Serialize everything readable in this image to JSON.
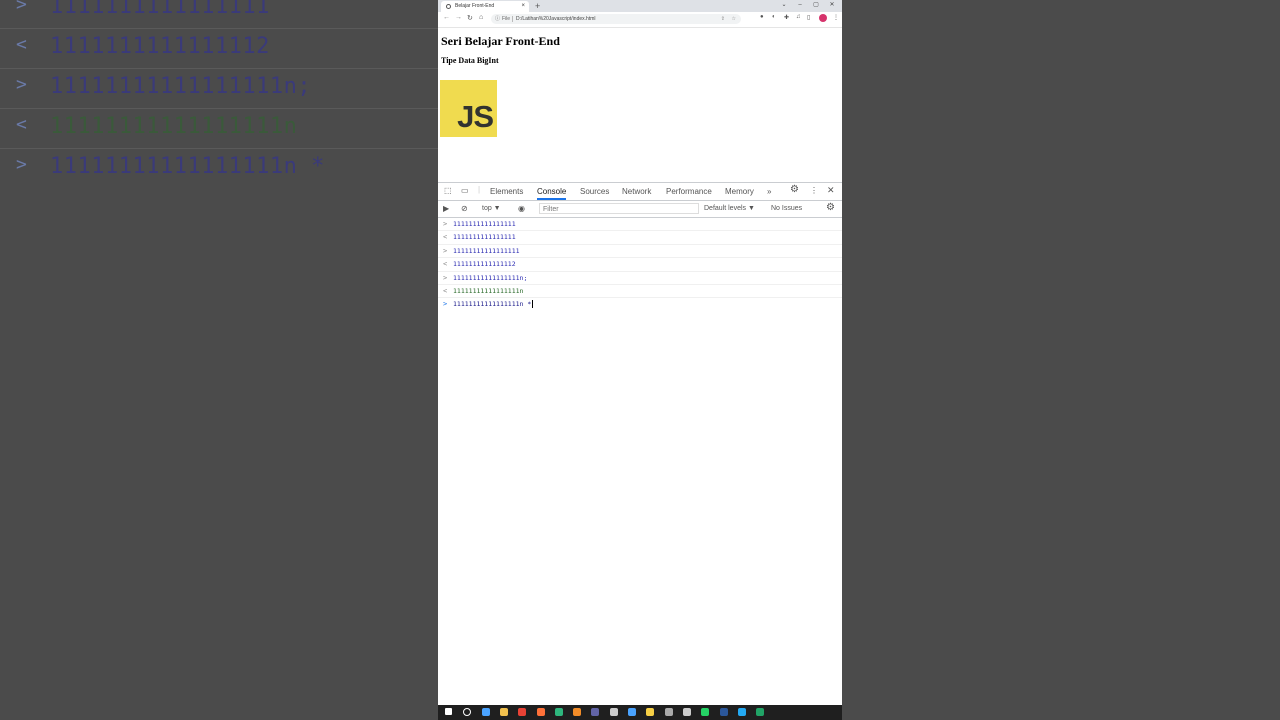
{
  "background": {
    "rows": [
      {
        "arrow": ">",
        "text": "1111111111111111",
        "color": "#3a3a7a"
      },
      {
        "arrow": "<",
        "text": "1111111111111112",
        "color": "#3a3a7a"
      },
      {
        "arrow": ">",
        "text": "11111111111111111n;",
        "color": "#3a3a7a"
      },
      {
        "arrow": "<",
        "text": "11111111111111111n",
        "color": "#3a5a3a"
      },
      {
        "arrow": ">",
        "text": "11111111111111111n *",
        "color": "#3a3a7a"
      }
    ]
  },
  "browser": {
    "tab_title": "Belajar Front-End",
    "tab_close": "×",
    "new_tab": "+",
    "window_controls": [
      "⌄",
      "–",
      "▢",
      "✕"
    ],
    "nav": {
      "back": "←",
      "forward": "→",
      "reload": "↻",
      "home": "⌂"
    },
    "address": {
      "info_icon": "ⓘ",
      "scheme_label": "File",
      "url": "D:/Latihan%20Javascript/index.html",
      "share_icon": "⇪",
      "star_icon": "☆"
    }
  },
  "page": {
    "heading": "Seri Belajar Front-End",
    "subheading": "Tipe Data BigInt",
    "logo_text": "JS"
  },
  "devtools": {
    "tabs": [
      "Elements",
      "Console",
      "Sources",
      "Network",
      "Performance",
      "Memory"
    ],
    "active_tab": "Console",
    "more_tabs": "»",
    "context": "top ▼",
    "filter_placeholder": "Filter",
    "levels": "Default levels ▼",
    "issues": "No Issues",
    "console": [
      {
        "kind": "in",
        "arrow": ">",
        "text": "1111111111111111"
      },
      {
        "kind": "out",
        "arrow": "<",
        "text": "1111111111111111"
      },
      {
        "kind": "in",
        "arrow": ">",
        "text": "11111111111111111"
      },
      {
        "kind": "out",
        "arrow": "<",
        "text": "1111111111111112"
      },
      {
        "kind": "in",
        "arrow": ">",
        "text": "11111111111111111n;"
      },
      {
        "kind": "outg",
        "arrow": "<",
        "text": "11111111111111111n"
      }
    ],
    "prompt": {
      "arrow": ">",
      "text": "11111111111111111n *"
    }
  },
  "taskbar_icons": [
    {
      "name": "windows-start-icon",
      "color": "#ffffff"
    },
    {
      "name": "search-icon",
      "color": "#ffffff"
    },
    {
      "name": "task-view-icon",
      "color": "#4aa3ff"
    },
    {
      "name": "file-explorer-icon",
      "color": "#f2c14e"
    },
    {
      "name": "chrome-icon",
      "color": "#e94235"
    },
    {
      "name": "firefox-icon",
      "color": "#ff7139"
    },
    {
      "name": "app-green-icon",
      "color": "#2eb67d"
    },
    {
      "name": "app-orange-icon",
      "color": "#f28c28"
    },
    {
      "name": "app-purple-icon",
      "color": "#6264a7"
    },
    {
      "name": "app-tool-icon",
      "color": "#cccccc"
    },
    {
      "name": "app-blue-icon",
      "color": "#4aa3ff"
    },
    {
      "name": "python-icon",
      "color": "#f7d046"
    },
    {
      "name": "app-generic-icon",
      "color": "#aaaaaa"
    },
    {
      "name": "calculator-icon",
      "color": "#cccccc"
    },
    {
      "name": "whatsapp-icon",
      "color": "#25d366"
    },
    {
      "name": "word-icon",
      "color": "#2b579a"
    },
    {
      "name": "vscode-icon",
      "color": "#23a9f2"
    },
    {
      "name": "excel-icon",
      "color": "#21a366"
    }
  ]
}
